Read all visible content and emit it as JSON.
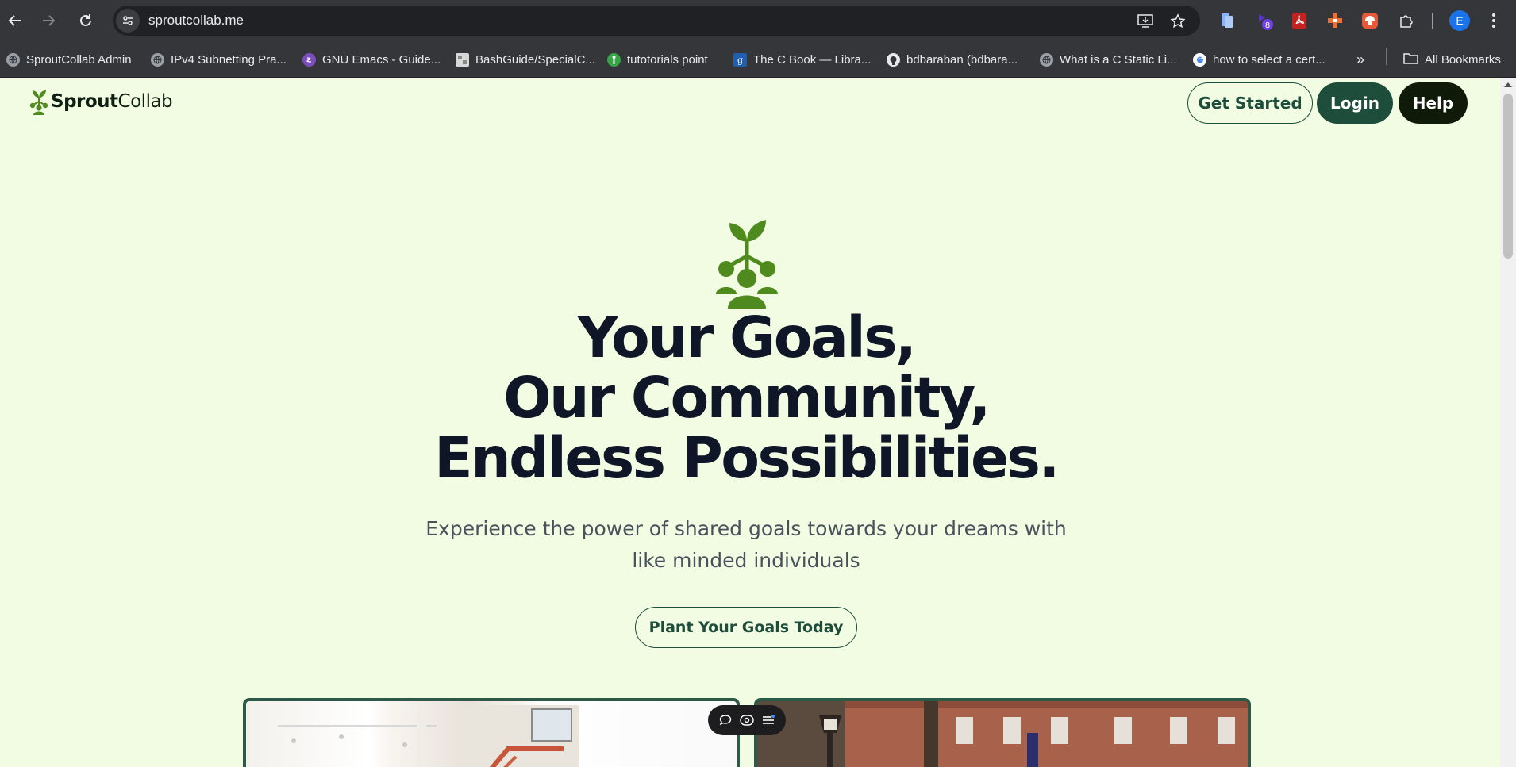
{
  "browser": {
    "url": "sproutcollab.me",
    "extension_badge": "8",
    "profile_initial": "E",
    "bookmarks": [
      {
        "label": "SproutCollab Admin",
        "icon": "globe-icon"
      },
      {
        "label": "IPv4 Subnetting Pra...",
        "icon": "globe-icon"
      },
      {
        "label": "GNU Emacs - Guide...",
        "icon": "emacs-icon"
      },
      {
        "label": "BashGuide/SpecialC...",
        "icon": "bashguide-icon"
      },
      {
        "label": "tutotorials point",
        "icon": "tutorialspoint-icon"
      },
      {
        "label": "The C Book — Libra...",
        "icon": "gbook-icon"
      },
      {
        "label": "bdbaraban (bdbara...",
        "icon": "github-icon"
      },
      {
        "label": "What is a C Static Li...",
        "icon": "globe-icon"
      },
      {
        "label": "how to select a cert...",
        "icon": "google-icon"
      }
    ],
    "all_bookmarks_label": "All Bookmarks"
  },
  "site": {
    "logo": {
      "bold": "Sprout",
      "regular": "Collab"
    },
    "nav": {
      "get_started": "Get Started",
      "login": "Login",
      "help": "Help"
    },
    "hero": {
      "headline": [
        "Your Goals,",
        "Our Community,",
        "Endless Possibilities."
      ],
      "subtitle": "Experience the power of shared goals towards your dreams with like minded individuals",
      "cta": "Plant Your Goals Today"
    }
  },
  "colors": {
    "page_background": "#f1fce3",
    "brand_green": "#4f8a1e",
    "dark_green": "#1e4d3b",
    "help_button": "#0f1a08",
    "headline": "#0f1627"
  }
}
